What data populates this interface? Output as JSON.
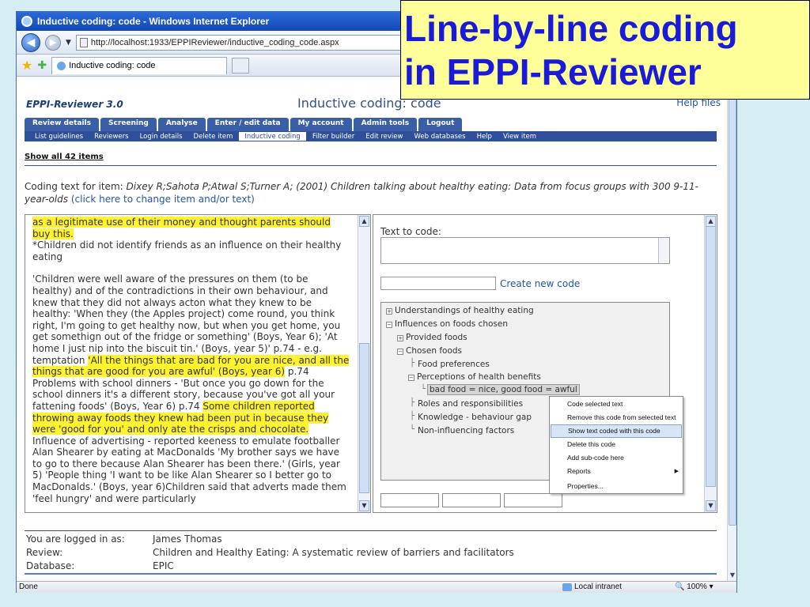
{
  "browser": {
    "window_title": "Inductive coding: code - Windows Internet Explorer",
    "url": "http://localhost:1933/EPPIReviewer/inductive_coding_code.aspx",
    "tab_title": "Inductive coding: code",
    "status_left": "Done",
    "status_zone": "Local intranet",
    "status_zoom": "100%"
  },
  "caption": {
    "line1": "Line-by-line coding",
    "line2": "in EPPI-Reviewer",
    "color": "#1a1adb",
    "background": "#ffff99"
  },
  "app": {
    "brand": "EPPI-Reviewer 3.0",
    "page_title": "Inductive coding: code",
    "help": "Help files",
    "menu_tabs": [
      "Review details",
      "Screening",
      "Analyse",
      "Enter / edit data",
      "My account",
      "Admin tools",
      "Logout"
    ],
    "submenu": [
      "List guidelines",
      "Reviewers",
      "Login details",
      "Delete item",
      "Inductive coding",
      "Filter builder",
      "Edit review",
      "Web databases",
      "Help",
      "View item"
    ],
    "active_submenu": "Inductive coding",
    "show_all": "Show all 42 items",
    "coding_label": "Coding text for item:",
    "item_ref": "Dixey R;Sahota P;Atwal S;Turner A; (2001) Children talking about healthy eating: Data from focus groups with 300 9-11-year-olds",
    "change_link": "(click here to change item and/or text)"
  },
  "left_text": {
    "p1_hl": "as a legitimate use of their money and thought parents should buy this.",
    "p1_rest": "*Children did not identify friends as an influence on their healthy eating",
    "p2_a": "'Children were well aware of the pressures on them (to be healthy) and of the contradictions in their own behaviour, and knew that they did not always acton what they knew to be healthy: 'When they (the Apples project) come round, you think right, I'm going to get healthy now, but when you get home, you get somethign out of the fridge or something' (Boys, Year 6); 'At home I just nip into the biscuit tin.' (Boys, year 5)' p.74 - e.g. temptation ",
    "p2_hl1": "'All the things that are bad for you are nice, and all the things that are good for you are awful' (Boys, year 6)",
    "p2_b": " p.74 Problems with school dinners - 'But once you go down for the school dinners it's a different story, because you've got all your fattening foods' (Boys, Year 6) p.74 ",
    "p2_hl2": "Some children reported throwing away foods they knew had been put in because they were 'good for you' and only ate the crisps and chocolate.",
    "p2_c": " Influence of advertising - reported keeness to emulate footballer Alan Shearer by eating at MacDonalds 'My brother says we have to go to there because Alan Shearer has been there.' (Girls, year 5) 'People thing 'I want to be like Alan Shearer so I better go to MacDonalds.' (Boys, year 6)Children said that adverts made them 'feel hungry' and were particularly"
  },
  "right_panel": {
    "text_to_code_label": "Text to code:",
    "create_code": "Create new code",
    "tree": [
      {
        "label": "Understandings of healthy eating",
        "toggle": "+"
      },
      {
        "label": "Influences on foods chosen",
        "toggle": "−"
      },
      {
        "label": "Provided foods",
        "toggle": "+"
      },
      {
        "label": "Chosen foods",
        "toggle": "−"
      },
      {
        "label": "Food preferences",
        "toggle": ""
      },
      {
        "label": "Perceptions of health benefits",
        "toggle": "−"
      },
      {
        "label": "bad food = nice, good food = awful",
        "toggle": ""
      },
      {
        "label": "Roles and responsibilities",
        "toggle": ""
      },
      {
        "label": "Knowledge - behaviour gap",
        "toggle": ""
      },
      {
        "label": "Non-influencing factors",
        "toggle": ""
      }
    ]
  },
  "context_menu": {
    "items": [
      "Code selected text",
      "Remove this code from selected text",
      "Show text coded with this code",
      "Delete this code",
      "Add sub-code here",
      "Reports",
      "Properties..."
    ],
    "hovered": "Show text coded with this code"
  },
  "footer": {
    "logged_in_label": "You are logged in as:",
    "logged_in_value": "James Thomas",
    "review_label": "Review:",
    "review_value": "Children and Healthy Eating: A systematic review of barriers and facilitators",
    "database_label": "Database:",
    "database_value": "EPIC"
  }
}
